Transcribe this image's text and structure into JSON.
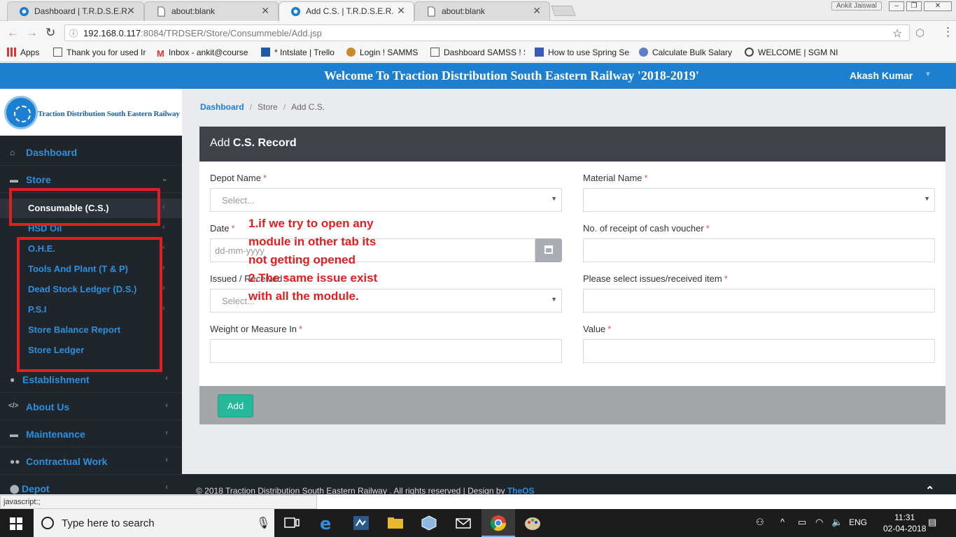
{
  "browser": {
    "tabs": [
      {
        "title": "Dashboard | T.R.D.S.E.R.",
        "active": false
      },
      {
        "title": "about:blank",
        "active": false
      },
      {
        "title": "Add C.S. | T.R.D.S.E.R.",
        "active": true
      },
      {
        "title": "about:blank",
        "active": false
      }
    ],
    "profile_name": "Ankit Jaiswal",
    "url_host": "192.168.0.117",
    "url_rest": ":8084/TRDSER/Store/Consummeble/Add.jsp",
    "bookmarks": [
      "Apps",
      "Thank you for used Ir",
      "Inbox - ankit@course",
      "* Intslate | Trello",
      "Login ! SAMMS",
      "Dashboard SAMSS ! S",
      "How to use Spring Se",
      "Calculate Bulk Salary",
      "WELCOME | SGM NID"
    ],
    "status_text": "javascript:;"
  },
  "header": {
    "title": "Welcome To Traction Distribution South Eastern Railway '2018-2019'",
    "user": "Akash Kumar"
  },
  "sidebar": {
    "logo_text": "Traction Distribution South Eastern Railway",
    "items": [
      {
        "label": "Dashboard",
        "icon": "home-icon"
      },
      {
        "label": "Store",
        "icon": "folder-icon"
      },
      {
        "label": "Establishment",
        "icon": "person-icon"
      },
      {
        "label": "About Us",
        "icon": "code-icon"
      },
      {
        "label": "Maintenance",
        "icon": "folder-icon"
      },
      {
        "label": "Contractual Work",
        "icon": "users-icon"
      },
      {
        "label": "Depot",
        "icon": "map-marker-icon"
      }
    ],
    "store_sub": [
      "Consumable (C.S.)",
      "HSD Oil",
      "O.H.E.",
      "Tools And Plant (T & P)",
      "Dead Stock Ledger (D.S.)",
      "P.S.I",
      "Store Balance Report",
      "Store Ledger"
    ]
  },
  "breadcrumb": {
    "home": "Dashboard",
    "section": "Store",
    "current": "Add C.S."
  },
  "panel": {
    "title_prefix": "Add",
    "title_bold": "C.S. Record",
    "fields": {
      "depot_label": "Depot Name",
      "depot_value": "Select...",
      "material_label": "Material Name",
      "date_label": "Date",
      "date_placeholder": "dd-mm-yyyy",
      "receipt_label": "No. of receipt of cash voucher",
      "issued_label": "Issued / Received",
      "issued_value": "Select...",
      "issues_item_label": "Please select issues/received item",
      "weight_label": "Weight or Measure In",
      "value_label": "Value",
      "required_mark": "*"
    },
    "add_button": "Add"
  },
  "annotation": {
    "text": "1.if we try to open any\nmodule in other tab  its\nnot getting opened\n2.The same issue exist\nwith all the module."
  },
  "footer": {
    "text": "© 2018 Traction Distribution South Eastern Railway . All rights reserved | Design by ",
    "brand": "TheOS"
  },
  "taskbar": {
    "search_placeholder": "Type here to search",
    "language": "ENG",
    "time": "11:31",
    "date": "02-04-2018"
  },
  "colors": {
    "header_blue": "#1d7fd0",
    "sidebar_dark": "#20252b",
    "link_blue": "#2a90e0",
    "add_green": "#25b89a",
    "annotation_red": "#e02020"
  }
}
